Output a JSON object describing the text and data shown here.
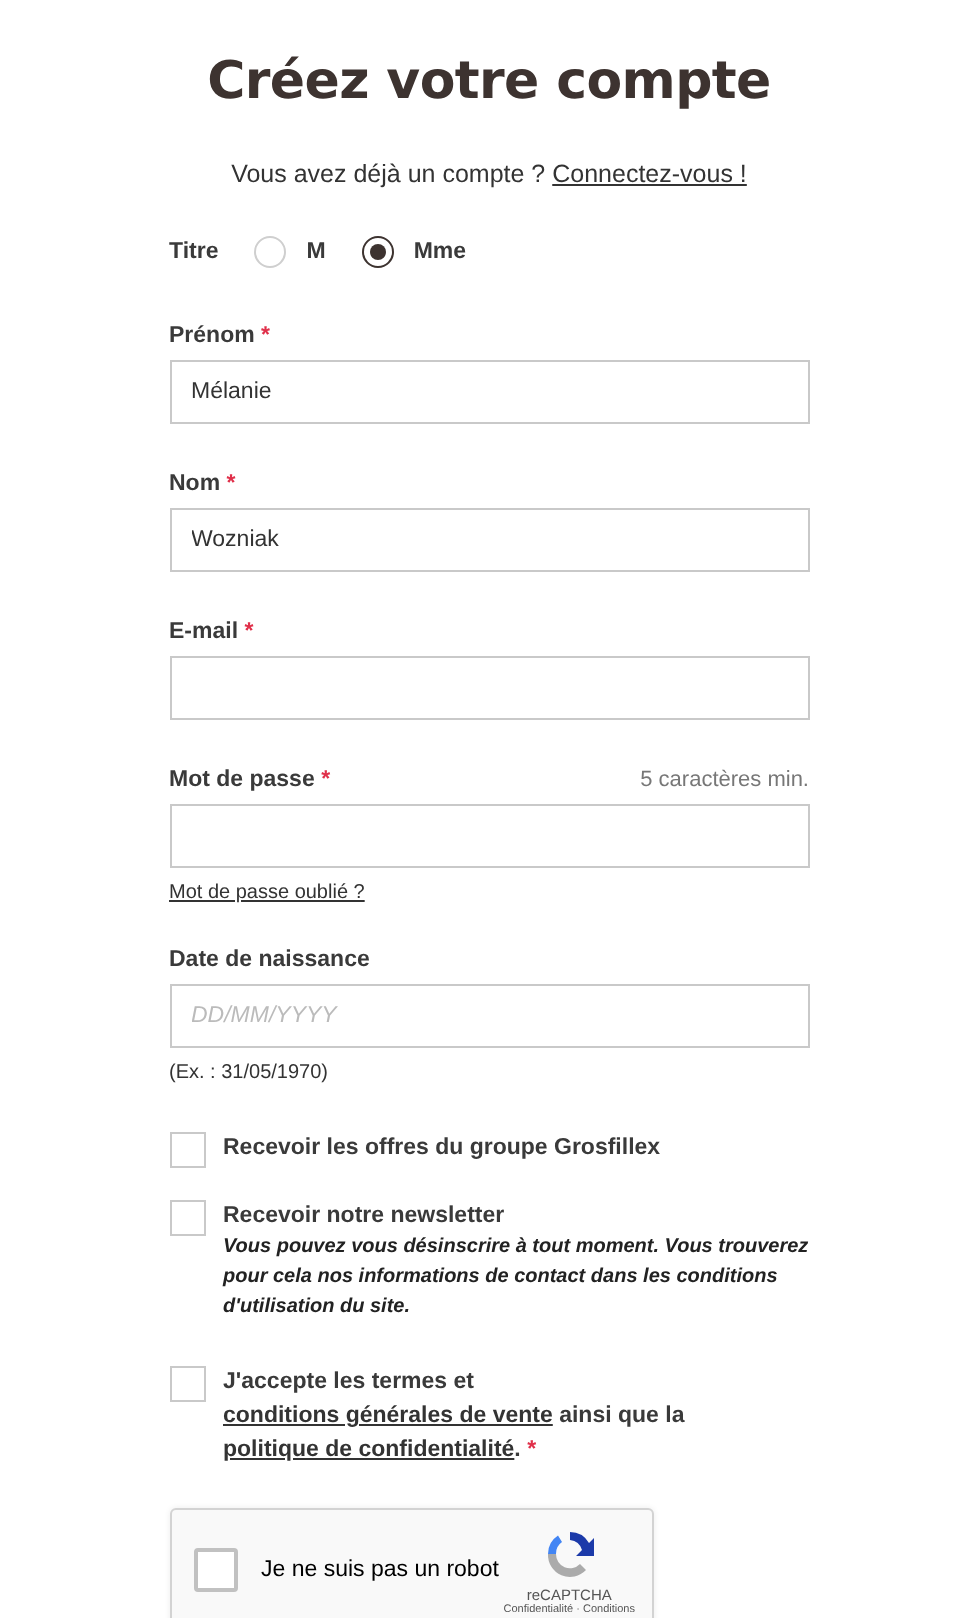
{
  "title": "Créez votre compte",
  "login_prompt": {
    "text": "Vous avez déjà un compte ?",
    "link": "Connectez-vous !"
  },
  "civility": {
    "label": "Titre",
    "options": [
      {
        "label": "M",
        "selected": false
      },
      {
        "label": "Mme",
        "selected": true
      }
    ]
  },
  "fields": [
    {
      "label": "Prénom",
      "required_mark": "*",
      "value": "Mélanie"
    },
    {
      "label": "Nom",
      "required_mark": "*",
      "value": "Wozniak"
    },
    {
      "label": "E-mail",
      "required_mark": "*"
    },
    {
      "label": "Mot de passe",
      "required_mark": "*",
      "hint": "5 caractères min.",
      "link": "Mot de passe oublié ?"
    },
    {
      "label": "Date de naissance",
      "placeholder": "DD/MM/YYYY",
      "help": "(Ex. : 31/05/1970)"
    }
  ],
  "checkboxes": [
    {
      "kind": "simple",
      "checked": false,
      "label": "Recevoir les offres du groupe Grosfillex"
    },
    {
      "kind": "note",
      "checked": false,
      "label": "Recevoir notre newsletter",
      "note": "Vous pouvez vous désinscrire à tout moment. Vous trouverez pour cela nos informations de contact dans les conditions d'utilisation du site."
    },
    {
      "kind": "terms",
      "checked": false,
      "required_mark": "*",
      "parts": [
        {
          "kind": "text",
          "text": "J'accepte les termes et "
        },
        {
          "kind": "link",
          "text": "conditions générales de vente"
        },
        {
          "kind": "text",
          "text": " ainsi que la "
        },
        {
          "kind": "link",
          "text": "politique de confidentialité"
        },
        {
          "kind": "text",
          "text": "."
        }
      ]
    }
  ],
  "captcha": {
    "label": "Je ne suis pas un robot",
    "checked": false,
    "brand": "reCAPTCHA",
    "privacy": "Confidentialité",
    "separator": "·",
    "terms": "Conditions"
  }
}
